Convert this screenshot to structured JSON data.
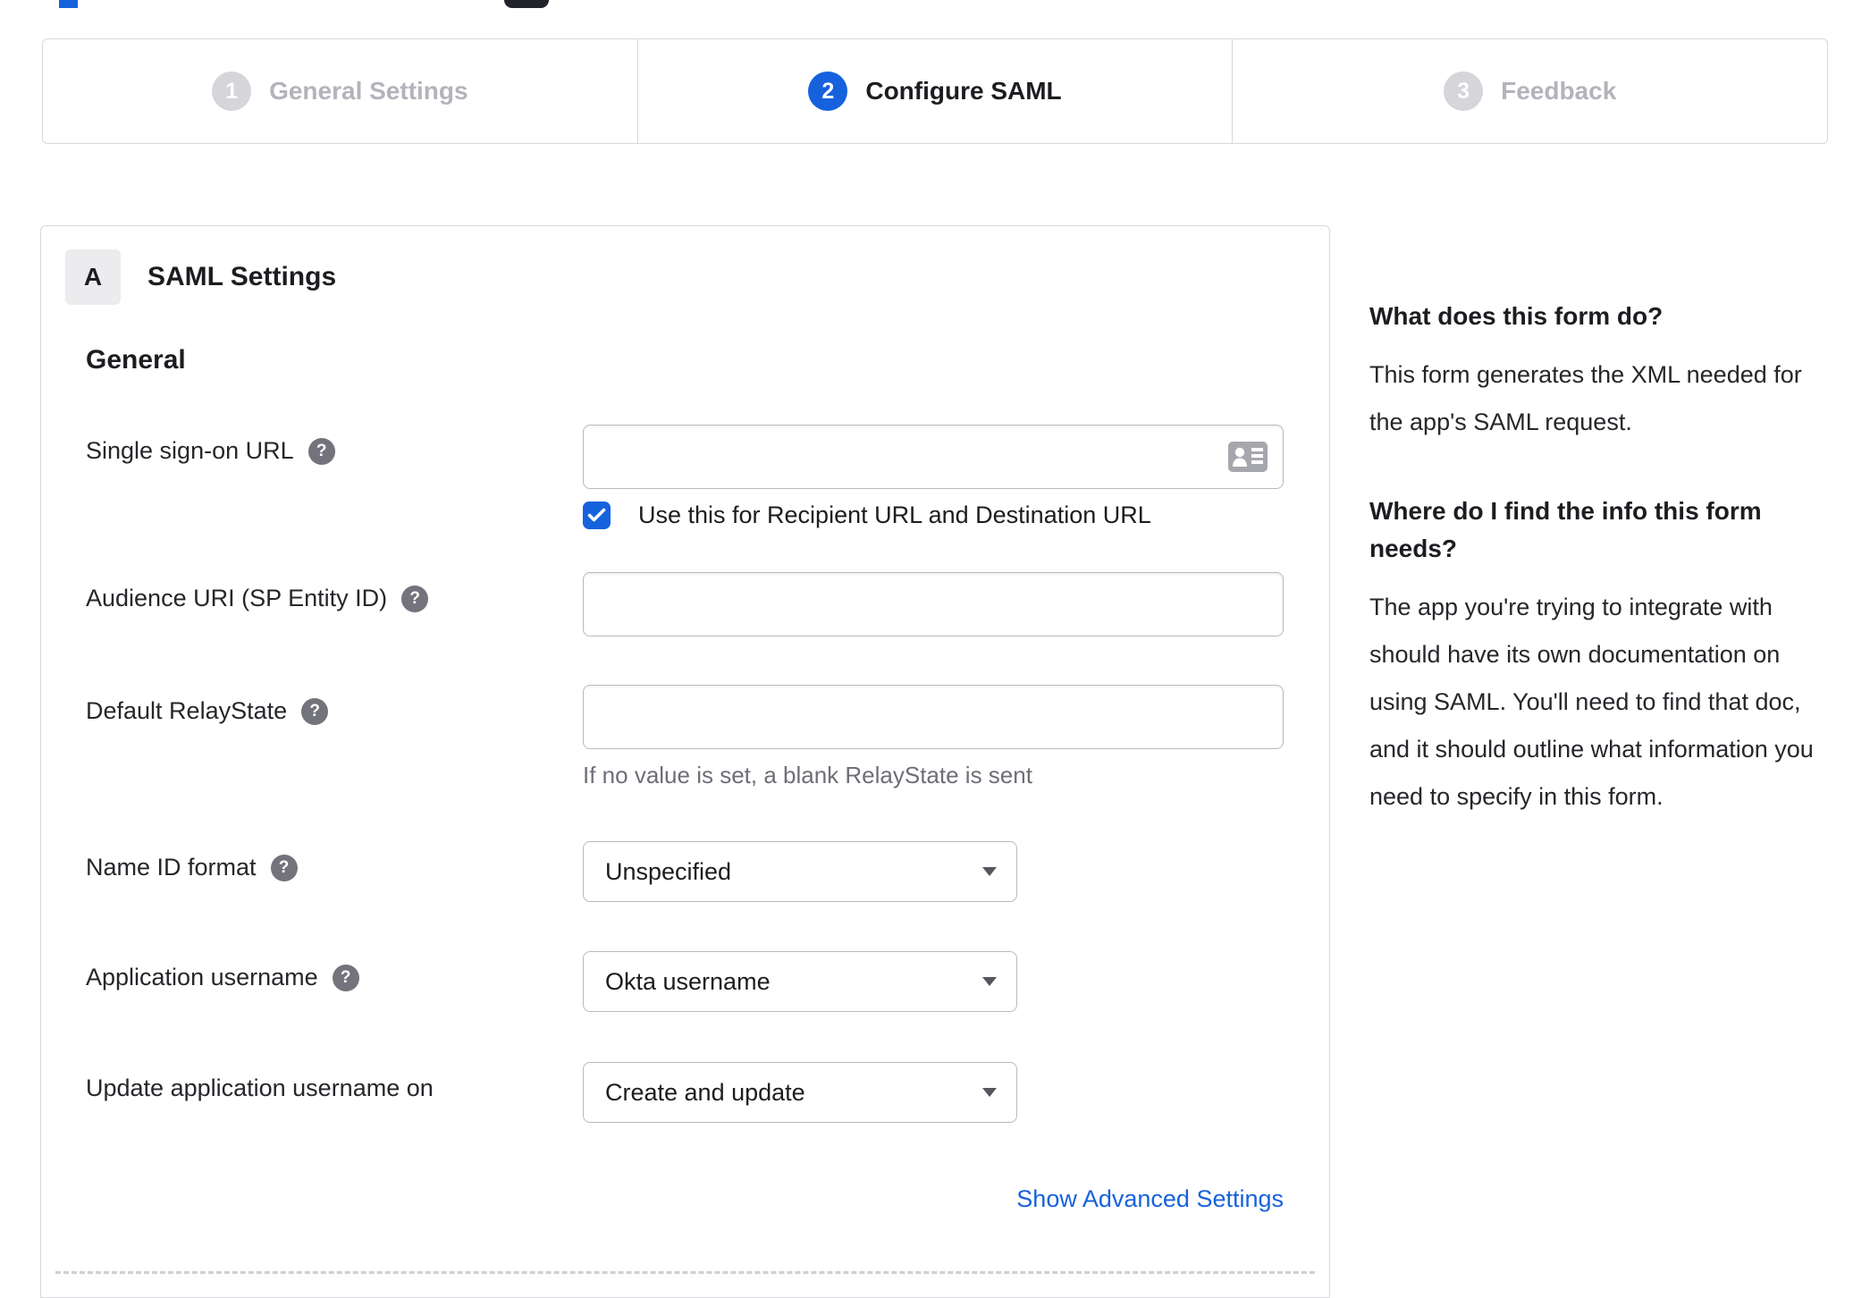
{
  "stepper": {
    "steps": [
      {
        "number": "1",
        "label": "General Settings"
      },
      {
        "number": "2",
        "label": "Configure SAML"
      },
      {
        "number": "3",
        "label": "Feedback"
      }
    ],
    "active_step": "Configure SAML"
  },
  "saml_panel": {
    "badge": "A",
    "title": "SAML Settings",
    "group_heading": "General",
    "fields": {
      "sso_url": {
        "label": "Single sign-on URL",
        "value": ""
      },
      "sso_checkbox": {
        "label": "Use this for Recipient URL and Destination URL",
        "checked": true
      },
      "audience_uri": {
        "label": "Audience URI (SP Entity ID)",
        "value": ""
      },
      "default_relaystate": {
        "label": "Default RelayState",
        "value": "",
        "helper_text": "If no value is set, a blank RelayState is sent"
      },
      "name_id_format": {
        "label": "Name ID format",
        "selected": "Unspecified"
      },
      "application_username": {
        "label": "Application username",
        "selected": "Okta username"
      },
      "update_application_username": {
        "label": "Update application username on",
        "selected": "Create and update"
      }
    },
    "advanced_link": "Show Advanced Settings"
  },
  "help_sidebar": {
    "sections": [
      {
        "heading": "What does this form do?",
        "body": "This form generates the XML needed for the app's SAML request."
      },
      {
        "heading": "Where do I find the info this form needs?",
        "body": "The app you're trying to integrate with should have its own documentation on using SAML. You'll need to find that doc, and it should outline what information you need to specify in this form."
      }
    ]
  },
  "colors": {
    "accent_blue": "#1662dd",
    "active_text": "#1d1d21",
    "inactive_text": "#b3b3bb",
    "helper_gray": "#6e6e78",
    "border_gray": "#d8d8dc"
  }
}
